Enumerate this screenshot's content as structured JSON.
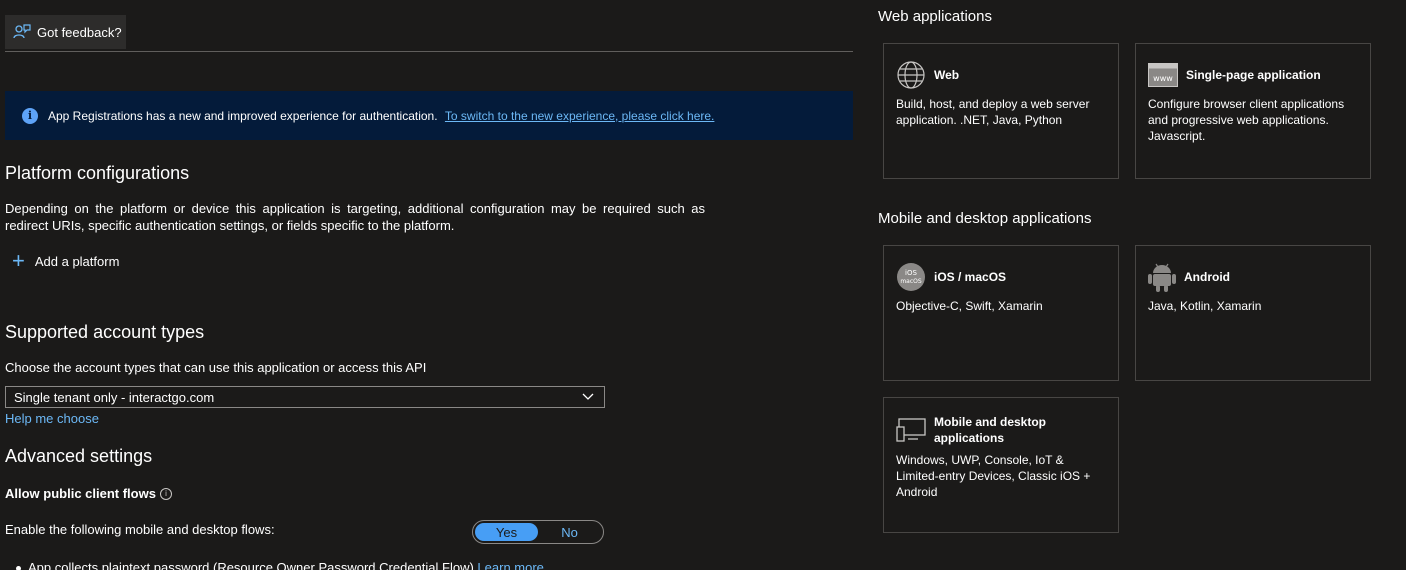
{
  "feedback": {
    "label": "Got feedback?"
  },
  "banner": {
    "text": "App Registrations has a new and improved experience for authentication.",
    "link": "To switch to the new experience, please click here."
  },
  "platform_configurations": {
    "title": "Platform configurations",
    "description": "Depending on the platform or device this application is targeting, additional configuration may be required such as redirect URIs, specific authentication settings, or fields specific to the platform.",
    "add_label": "Add a platform"
  },
  "supported_accounts": {
    "title": "Supported account types",
    "prompt": "Choose the account types that can use this application or access this API",
    "selected": "Single tenant only - interactgo.com",
    "help_link": "Help me choose"
  },
  "advanced": {
    "title": "Advanced settings",
    "public_client_label": "Allow public client flows",
    "flows_label": "Enable the following mobile and desktop flows:",
    "toggle_yes": "Yes",
    "toggle_no": "No",
    "toggle_value": "Yes",
    "bullet_text": "App collects plaintext password (Resource Owner Password Credential Flow)",
    "bullet_link": "Learn more"
  },
  "panel": {
    "web_section": "Web applications",
    "mobile_section": "Mobile and desktop applications",
    "cards": {
      "web": {
        "title": "Web",
        "body": "Build, host, and deploy a web server application. .NET, Java, Python",
        "icon": "globe-icon"
      },
      "spa": {
        "title": "Single-page application",
        "body": "Configure browser client applications and progressive web applications. Javascript.",
        "icon": "www-icon"
      },
      "ios": {
        "title": "iOS / macOS",
        "body": "Objective-C, Swift, Xamarin",
        "icon": "ios-macos-icon"
      },
      "android": {
        "title": "Android",
        "body": "Java, Kotlin, Xamarin",
        "icon": "android-icon"
      },
      "desktop": {
        "title": "Mobile and desktop applications",
        "body": "Windows, UWP, Console, IoT & Limited-entry Devices, Classic iOS + Android",
        "icon": "desktop-icon"
      }
    }
  },
  "colors": {
    "background": "#1b1a19",
    "accent": "#479ef5",
    "link": "#6cb8f6",
    "banner": "#041b3a"
  }
}
